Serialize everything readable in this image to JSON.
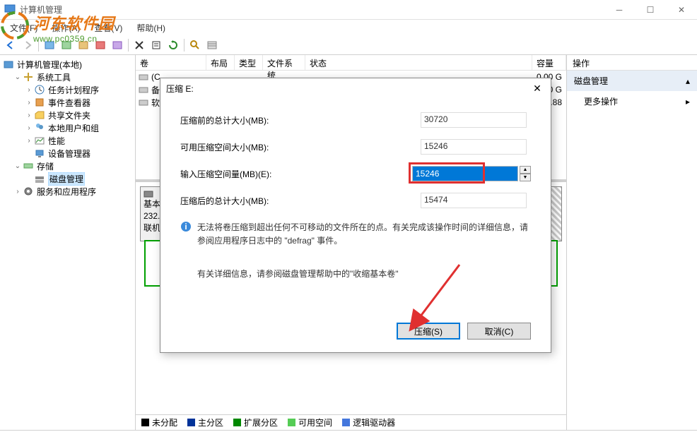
{
  "window": {
    "title": "计算机管理"
  },
  "watermark": {
    "title": "河东软件园",
    "url": "www.pc0359.cn"
  },
  "menu": {
    "file": "文件(F)",
    "action": "操作(A)",
    "view": "查看(V)",
    "help": "帮助(H)"
  },
  "tree": {
    "root": "计算机管理(本地)",
    "system_tools": "系统工具",
    "task_scheduler": "任务计划程序",
    "event_viewer": "事件查看器",
    "shared_folders": "共享文件夹",
    "local_users": "本地用户和组",
    "performance": "性能",
    "device_manager": "设备管理器",
    "storage": "存储",
    "disk_management": "磁盘管理",
    "services_apps": "服务和应用程序"
  },
  "list": {
    "cols": {
      "volume": "卷",
      "layout": "布局",
      "type": "类型",
      "fs": "文件系统",
      "status": "状态",
      "capacity": "容量"
    },
    "rows": [
      {
        "name": "(C",
        "cap": "0.00 G"
      },
      {
        "name": "备",
        "cap": "0.00 G"
      },
      {
        "name": "软",
        "cap": "42.88"
      }
    ]
  },
  "disk": {
    "label": "基本",
    "size": "232.",
    "status": "联机"
  },
  "legend": {
    "unallocated": "未分配",
    "primary": "主分区",
    "extended": "扩展分区",
    "free": "可用空间",
    "logical": "逻辑驱动器"
  },
  "actions": {
    "header": "操作",
    "disk_mgmt": "磁盘管理",
    "more": "更多操作"
  },
  "dialog": {
    "title": "压缩 E:",
    "total_before_label": "压缩前的总计大小(MB):",
    "total_before": "30720",
    "avail_label": "可用压缩空间大小(MB):",
    "avail": "15246",
    "input_label": "输入压缩空间量(MB)(E):",
    "input": "15246",
    "total_after_label": "压缩后的总计大小(MB):",
    "total_after": "15474",
    "info1": "无法将卷压缩到超出任何不可移动的文件所在的点。有关完成该操作时间的详细信息，请参阅应用程序日志中的 \"defrag\" 事件。",
    "info2": "有关详细信息，请参阅磁盘管理帮助中的\"收缩基本卷\"",
    "shrink_btn": "压缩(S)",
    "cancel_btn": "取消(C)"
  }
}
